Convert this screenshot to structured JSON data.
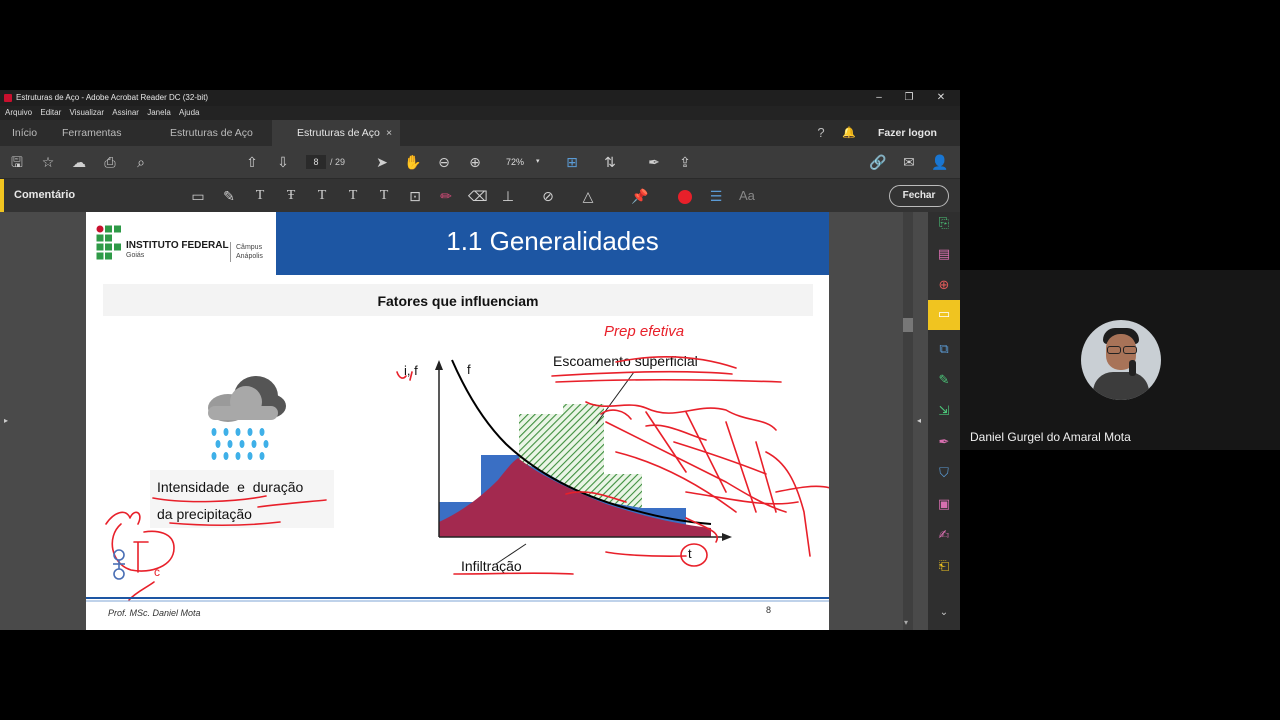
{
  "window": {
    "title": "Estruturas de Aço - Adobe Acrobat Reader DC (32-bit)",
    "controls": [
      "–",
      "❐",
      "✕"
    ]
  },
  "menu": [
    "Arquivo",
    "Editar",
    "Visualizar",
    "Assinar",
    "Janela",
    "Ajuda"
  ],
  "tabs": {
    "home": "Início",
    "tools": "Ferramentas",
    "doc1": "Estruturas de Aço",
    "doc2": "Estruturas de Aço",
    "close": "×",
    "login": "Fazer logon"
  },
  "toolbar": {
    "page_current": "8",
    "page_total": "/ 29",
    "zoom": "72%"
  },
  "comment_bar": {
    "label": "Comentário",
    "font_label": "Aa",
    "close": "Fechar"
  },
  "slide": {
    "institution": "INSTITUTO FEDERAL",
    "state": "Goiás",
    "campus": "Câmpus",
    "campus_city": "Anápolis",
    "title": "1.1 Generalidades",
    "subtitle": "Fatores que influenciam",
    "caption_line1": "Intensidade  e  duração",
    "caption_line2": "da precipitação",
    "axis_y": "i, f",
    "curve_label": "f",
    "axis_x": "t",
    "label_runoff": "Escoamento superficial",
    "label_infiltration": "Infiltração",
    "footer_author": "Prof. MSc. Daniel Mota",
    "page_number": "8",
    "annotations": {
      "handwriting": "Prep  efetiva",
      "tc_sub": "c"
    }
  },
  "participant": {
    "name": "Daniel Gurgel do Amaral Mota"
  },
  "colors": {
    "acrobat_accent": "#f0c420",
    "slide_blue": "#1d56a3",
    "ink_red": "#e8202a",
    "infiltration": "#a3294f",
    "rain_area": "#3a6fc4",
    "runoff_hatch": "#3e8f3e"
  }
}
